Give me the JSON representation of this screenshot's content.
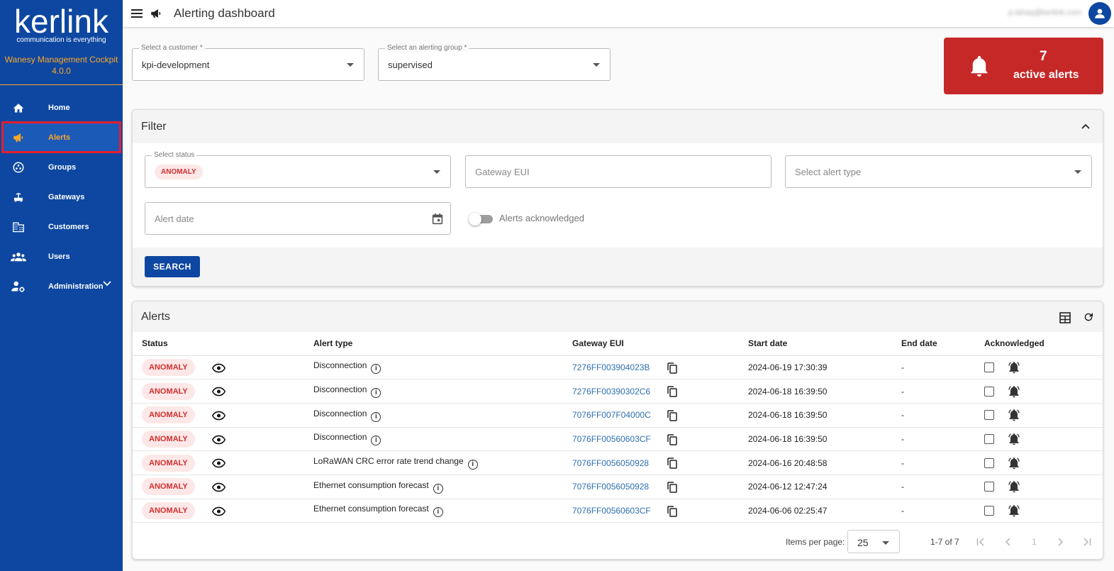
{
  "sidebar": {
    "logo_text": "kerlink",
    "logo_tagline": "communication is everything",
    "app_name": "Wanesy Management Cockpit",
    "version": "4.0.0",
    "items": [
      {
        "label": "Home",
        "icon": "home-icon"
      },
      {
        "label": "Alerts",
        "icon": "megaphone-icon"
      },
      {
        "label": "Groups",
        "icon": "groups-icon"
      },
      {
        "label": "Gateways",
        "icon": "gateway-icon"
      },
      {
        "label": "Customers",
        "icon": "building-icon"
      },
      {
        "label": "Users",
        "icon": "users-icon"
      },
      {
        "label": "Administration",
        "icon": "admin-icon"
      }
    ]
  },
  "header": {
    "title": "Alerting dashboard",
    "user_email": "p.lahaq@kerlink.com"
  },
  "selectors": {
    "customer_label": "Select a customer *",
    "customer_value": "kpi-development",
    "group_label": "Select an alerting group *",
    "group_value": "supervised"
  },
  "active_alerts": {
    "count": "7",
    "label": "active alerts"
  },
  "filter": {
    "title": "Filter",
    "status_label": "Select status",
    "status_value": "ANOMALY",
    "gateway_placeholder": "Gateway EUI",
    "alert_type_placeholder": "Select alert type",
    "date_placeholder": "Alert date",
    "ack_label": "Alerts acknowledged",
    "search_label": "SEARCH"
  },
  "alerts": {
    "title": "Alerts",
    "columns": [
      "Status",
      "Alert type",
      "Gateway EUI",
      "Start date",
      "End date",
      "Acknowledged"
    ],
    "rows": [
      {
        "status": "ANOMALY",
        "type": "Disconnection",
        "gateway": "7276FF003904023B",
        "start": "2024-06-19 17:30:39",
        "end": "-"
      },
      {
        "status": "ANOMALY",
        "type": "Disconnection",
        "gateway": "7276FF00390302C6",
        "start": "2024-06-18 16:39:50",
        "end": "-"
      },
      {
        "status": "ANOMALY",
        "type": "Disconnection",
        "gateway": "7076FF007F04000C",
        "start": "2024-06-18 16:39:50",
        "end": "-"
      },
      {
        "status": "ANOMALY",
        "type": "Disconnection",
        "gateway": "7076FF00560603CF",
        "start": "2024-06-18 16:39:50",
        "end": "-"
      },
      {
        "status": "ANOMALY",
        "type": "LoRaWAN CRC error rate trend change",
        "gateway": "7076FF0056050928",
        "start": "2024-06-16 20:48:58",
        "end": "-"
      },
      {
        "status": "ANOMALY",
        "type": "Ethernet consumption forecast",
        "gateway": "7076FF0056050928",
        "start": "2024-06-12 12:47:24",
        "end": "-"
      },
      {
        "status": "ANOMALY",
        "type": "Ethernet consumption forecast",
        "gateway": "7076FF00560603CF",
        "start": "2024-06-06 02:25:47",
        "end": "-"
      }
    ]
  },
  "paginator": {
    "items_label": "Items per page:",
    "page_size": "25",
    "range": "1-7 of 7",
    "page": "1"
  }
}
